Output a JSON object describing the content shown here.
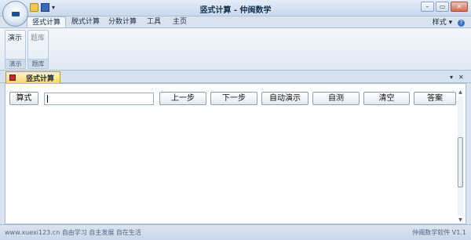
{
  "window": {
    "title": "竖式计算 - 仲闽数学",
    "buttons": {
      "minimize": "–",
      "restore": "▭",
      "close": "✕"
    }
  },
  "quick_access": {
    "icons": [
      "open-folder-icon",
      "save-icon",
      "dropdown-icon"
    ],
    "more": "▾"
  },
  "ribbon": {
    "tabs": [
      "竖式计算",
      "脱式计算",
      "分数计算",
      "工具",
      "主页"
    ],
    "active_tab": "竖式计算",
    "style_menu": "样式",
    "style_arrow": "▾",
    "help": "?",
    "groups": [
      {
        "button": "演示",
        "label": "演示"
      },
      {
        "button": "题库",
        "label": "题库"
      }
    ]
  },
  "document_tab": {
    "label": "竖式计算",
    "menu_arrow": "▾",
    "close": "✕"
  },
  "toolbar": {
    "formula_label": "算式",
    "input_value": "",
    "prev_step": "上一步",
    "next_step": "下一步",
    "auto_demo": "自动演示",
    "self_test": "自测",
    "clear": "清空",
    "answer": "答案"
  },
  "scrollbar": {
    "up": "▲",
    "down": "▼"
  },
  "statusbar": {
    "left": "www.xuexi123.cn 自由学习 自主发展 自在生活",
    "right": "仲闽数学软件 V1.1"
  },
  "colors": {
    "accent": "#f7d56c",
    "ribbon_bg": "#dfe8f3",
    "brand_blue": "#3d69b5"
  }
}
